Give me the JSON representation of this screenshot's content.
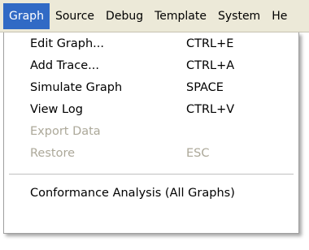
{
  "menubar": {
    "items": [
      {
        "label": "Graph"
      },
      {
        "label": "Source"
      },
      {
        "label": "Debug"
      },
      {
        "label": "Template"
      },
      {
        "label": "System"
      },
      {
        "label": "He"
      }
    ]
  },
  "graph_menu": {
    "items": [
      {
        "label": "Edit Graph...",
        "shortcut": "CTRL+E",
        "enabled": true
      },
      {
        "label": "Add Trace...",
        "shortcut": "CTRL+A",
        "enabled": true
      },
      {
        "label": "Simulate Graph",
        "shortcut": "SPACE",
        "enabled": true
      },
      {
        "label": "View Log",
        "shortcut": "CTRL+V",
        "enabled": true
      },
      {
        "label": "Export Data",
        "shortcut": "",
        "enabled": false
      },
      {
        "label": "Restore",
        "shortcut": "ESC",
        "enabled": false
      }
    ],
    "footer_item": {
      "label": "Conformance Analysis (All Graphs)",
      "enabled": true
    }
  }
}
